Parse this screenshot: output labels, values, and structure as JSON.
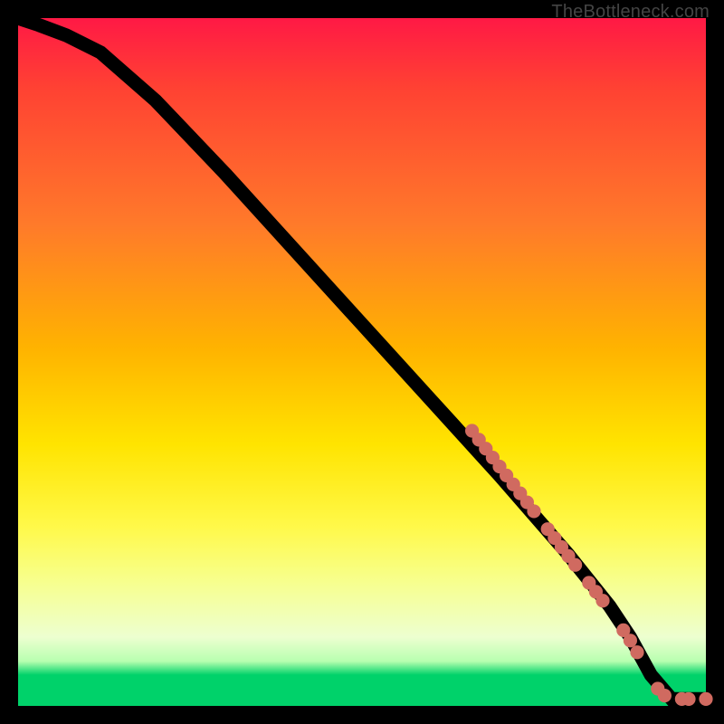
{
  "watermark": "TheBottleneck.com",
  "colors": {
    "bg_black": "#000000",
    "gradient_top": "#ff1945",
    "gradient_mid1": "#ff7a2a",
    "gradient_mid2": "#ffe400",
    "gradient_mid3": "#f7ff60",
    "gradient_green": "#00d26a",
    "marker": "#d06a60",
    "curve": "#000000"
  },
  "gradient_css": "linear-gradient(to bottom, #ff1945 0%, #ff4133 10%, #ff7a2a 30%, #ffb300 48%, #ffe400 62%, #fff94a 74%, #f7ff8e 82%, #edffd0 90%, #b8ffb0 93.5%, #00d26a 95.5%, #00d26a 100%)",
  "chart_data": {
    "type": "line",
    "title": "",
    "xlabel": "",
    "ylabel": "",
    "xlim": [
      0,
      100
    ],
    "ylim": [
      0,
      100
    ],
    "x": [
      0,
      3,
      7,
      12,
      20,
      30,
      40,
      50,
      60,
      70,
      80,
      86,
      89,
      92,
      95,
      100
    ],
    "values": [
      100,
      99,
      97.5,
      95,
      88,
      77.5,
      66.5,
      55.5,
      44.5,
      33.5,
      22,
      14.5,
      10,
      4.5,
      1,
      1
    ],
    "markers": {
      "comment": "cluster of salmon dots along lower-right segment of curve",
      "points_xy": [
        [
          66,
          40
        ],
        [
          67,
          38.7
        ],
        [
          68,
          37.4
        ],
        [
          69,
          36.1
        ],
        [
          70,
          34.8
        ],
        [
          71,
          33.5
        ],
        [
          72,
          32.2
        ],
        [
          73,
          30.9
        ],
        [
          74,
          29.6
        ],
        [
          75,
          28.3
        ],
        [
          77,
          25.7
        ],
        [
          78,
          24.4
        ],
        [
          79,
          23.1
        ],
        [
          80,
          21.8
        ],
        [
          81,
          20.5
        ],
        [
          83,
          17.9
        ],
        [
          84,
          16.6
        ],
        [
          85,
          15.3
        ],
        [
          88,
          11.0
        ],
        [
          89,
          9.5
        ],
        [
          90,
          7.8
        ],
        [
          93,
          2.5
        ],
        [
          94,
          1.5
        ],
        [
          96.5,
          1
        ],
        [
          97.5,
          1
        ],
        [
          100,
          1
        ]
      ]
    }
  }
}
